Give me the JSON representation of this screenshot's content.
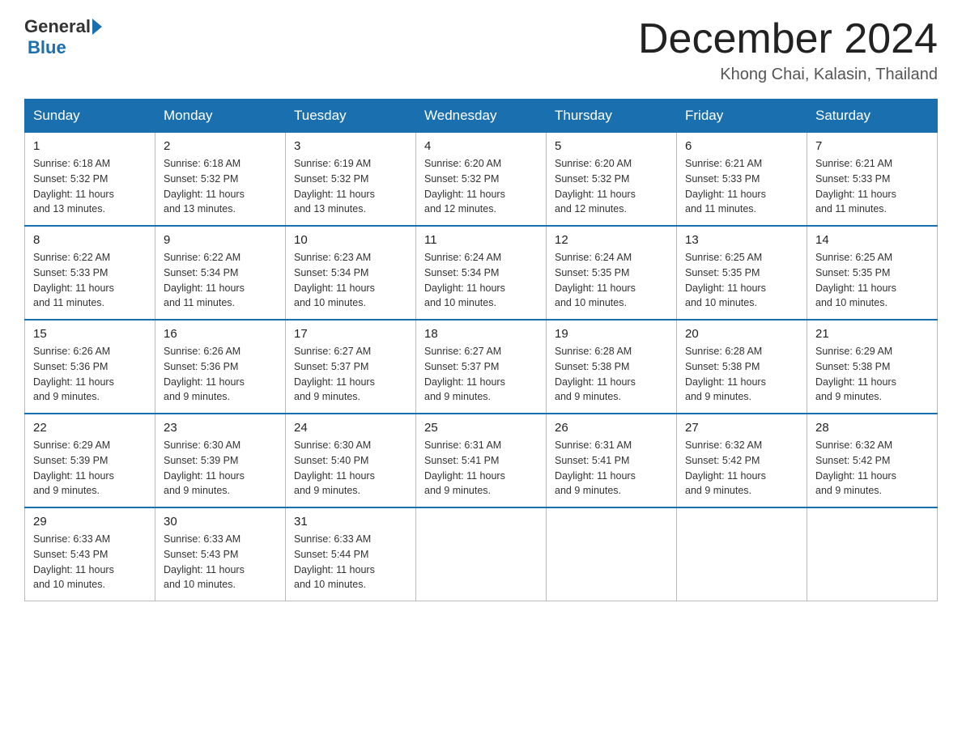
{
  "header": {
    "logo_general": "General",
    "logo_blue": "Blue",
    "month_title": "December 2024",
    "location": "Khong Chai, Kalasin, Thailand"
  },
  "weekdays": [
    "Sunday",
    "Monday",
    "Tuesday",
    "Wednesday",
    "Thursday",
    "Friday",
    "Saturday"
  ],
  "weeks": [
    [
      {
        "day": "1",
        "sunrise": "6:18 AM",
        "sunset": "5:32 PM",
        "daylight": "11 hours and 13 minutes."
      },
      {
        "day": "2",
        "sunrise": "6:18 AM",
        "sunset": "5:32 PM",
        "daylight": "11 hours and 13 minutes."
      },
      {
        "day": "3",
        "sunrise": "6:19 AM",
        "sunset": "5:32 PM",
        "daylight": "11 hours and 13 minutes."
      },
      {
        "day": "4",
        "sunrise": "6:20 AM",
        "sunset": "5:32 PM",
        "daylight": "11 hours and 12 minutes."
      },
      {
        "day": "5",
        "sunrise": "6:20 AM",
        "sunset": "5:32 PM",
        "daylight": "11 hours and 12 minutes."
      },
      {
        "day": "6",
        "sunrise": "6:21 AM",
        "sunset": "5:33 PM",
        "daylight": "11 hours and 11 minutes."
      },
      {
        "day": "7",
        "sunrise": "6:21 AM",
        "sunset": "5:33 PM",
        "daylight": "11 hours and 11 minutes."
      }
    ],
    [
      {
        "day": "8",
        "sunrise": "6:22 AM",
        "sunset": "5:33 PM",
        "daylight": "11 hours and 11 minutes."
      },
      {
        "day": "9",
        "sunrise": "6:22 AM",
        "sunset": "5:34 PM",
        "daylight": "11 hours and 11 minutes."
      },
      {
        "day": "10",
        "sunrise": "6:23 AM",
        "sunset": "5:34 PM",
        "daylight": "11 hours and 10 minutes."
      },
      {
        "day": "11",
        "sunrise": "6:24 AM",
        "sunset": "5:34 PM",
        "daylight": "11 hours and 10 minutes."
      },
      {
        "day": "12",
        "sunrise": "6:24 AM",
        "sunset": "5:35 PM",
        "daylight": "11 hours and 10 minutes."
      },
      {
        "day": "13",
        "sunrise": "6:25 AM",
        "sunset": "5:35 PM",
        "daylight": "11 hours and 10 minutes."
      },
      {
        "day": "14",
        "sunrise": "6:25 AM",
        "sunset": "5:35 PM",
        "daylight": "11 hours and 10 minutes."
      }
    ],
    [
      {
        "day": "15",
        "sunrise": "6:26 AM",
        "sunset": "5:36 PM",
        "daylight": "11 hours and 9 minutes."
      },
      {
        "day": "16",
        "sunrise": "6:26 AM",
        "sunset": "5:36 PM",
        "daylight": "11 hours and 9 minutes."
      },
      {
        "day": "17",
        "sunrise": "6:27 AM",
        "sunset": "5:37 PM",
        "daylight": "11 hours and 9 minutes."
      },
      {
        "day": "18",
        "sunrise": "6:27 AM",
        "sunset": "5:37 PM",
        "daylight": "11 hours and 9 minutes."
      },
      {
        "day": "19",
        "sunrise": "6:28 AM",
        "sunset": "5:38 PM",
        "daylight": "11 hours and 9 minutes."
      },
      {
        "day": "20",
        "sunrise": "6:28 AM",
        "sunset": "5:38 PM",
        "daylight": "11 hours and 9 minutes."
      },
      {
        "day": "21",
        "sunrise": "6:29 AM",
        "sunset": "5:38 PM",
        "daylight": "11 hours and 9 minutes."
      }
    ],
    [
      {
        "day": "22",
        "sunrise": "6:29 AM",
        "sunset": "5:39 PM",
        "daylight": "11 hours and 9 minutes."
      },
      {
        "day": "23",
        "sunrise": "6:30 AM",
        "sunset": "5:39 PM",
        "daylight": "11 hours and 9 minutes."
      },
      {
        "day": "24",
        "sunrise": "6:30 AM",
        "sunset": "5:40 PM",
        "daylight": "11 hours and 9 minutes."
      },
      {
        "day": "25",
        "sunrise": "6:31 AM",
        "sunset": "5:41 PM",
        "daylight": "11 hours and 9 minutes."
      },
      {
        "day": "26",
        "sunrise": "6:31 AM",
        "sunset": "5:41 PM",
        "daylight": "11 hours and 9 minutes."
      },
      {
        "day": "27",
        "sunrise": "6:32 AM",
        "sunset": "5:42 PM",
        "daylight": "11 hours and 9 minutes."
      },
      {
        "day": "28",
        "sunrise": "6:32 AM",
        "sunset": "5:42 PM",
        "daylight": "11 hours and 9 minutes."
      }
    ],
    [
      {
        "day": "29",
        "sunrise": "6:33 AM",
        "sunset": "5:43 PM",
        "daylight": "11 hours and 10 minutes."
      },
      {
        "day": "30",
        "sunrise": "6:33 AM",
        "sunset": "5:43 PM",
        "daylight": "11 hours and 10 minutes."
      },
      {
        "day": "31",
        "sunrise": "6:33 AM",
        "sunset": "5:44 PM",
        "daylight": "11 hours and 10 minutes."
      },
      null,
      null,
      null,
      null
    ]
  ],
  "labels": {
    "sunrise": "Sunrise:",
    "sunset": "Sunset:",
    "daylight": "Daylight:"
  }
}
